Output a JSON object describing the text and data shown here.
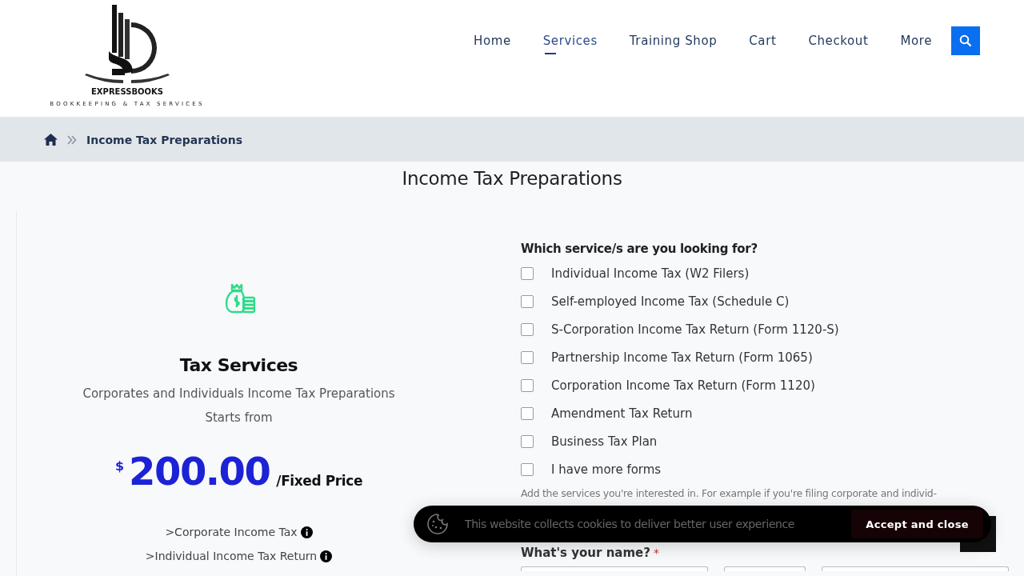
{
  "logo": {
    "name": "EXPRESSBOOKS",
    "tagline": "BOOKKEEPING & TAX SERVICES"
  },
  "nav": [
    {
      "label": "Home",
      "selected": false
    },
    {
      "label": "Services",
      "selected": true
    },
    {
      "label": "Training Shop",
      "selected": false
    },
    {
      "label": "Cart",
      "selected": false
    },
    {
      "label": "Checkout",
      "selected": false
    },
    {
      "label": "More",
      "selected": false
    }
  ],
  "breadcrumb": {
    "current": "Income Tax Preparations"
  },
  "page_title": "Income Tax Preparations",
  "card": {
    "title": "Tax Services",
    "description": "Corporates and Individuals Income Tax Preparations",
    "starts_from": "Starts from",
    "currency": "$",
    "price": "200.00",
    "price_unit": "/Fixed Price",
    "features": [
      ">Corporate Income Tax",
      ">Individual Income Tax Return"
    ]
  },
  "form": {
    "question": "Which service/s are you looking for?",
    "options": [
      {
        "label": "Individual Income Tax (W2 Filers)",
        "checked": false
      },
      {
        "label": "Self-employed Income Tax (Schedule C)",
        "checked": false
      },
      {
        "label": "S-Corporation Income Tax Return (Form 1120-S)",
        "checked": false
      },
      {
        "label": "Partnership Income Tax Return (Form 1065)",
        "checked": false
      },
      {
        "label": "Corporation Income Tax Return (Form 1120)",
        "checked": false
      },
      {
        "label": "Amendment Tax Return",
        "checked": false
      },
      {
        "label": "Business Tax Plan",
        "checked": false
      },
      {
        "label": "I have more forms",
        "checked": false
      }
    ],
    "hint": "Add the services you're interested in. For example if you're filing corporate and individ-",
    "name_label": "What's your name?",
    "required_mark": "*"
  },
  "cookie": {
    "message": "This website collects cookies to deliver better user experience",
    "button": "Accept and close"
  }
}
